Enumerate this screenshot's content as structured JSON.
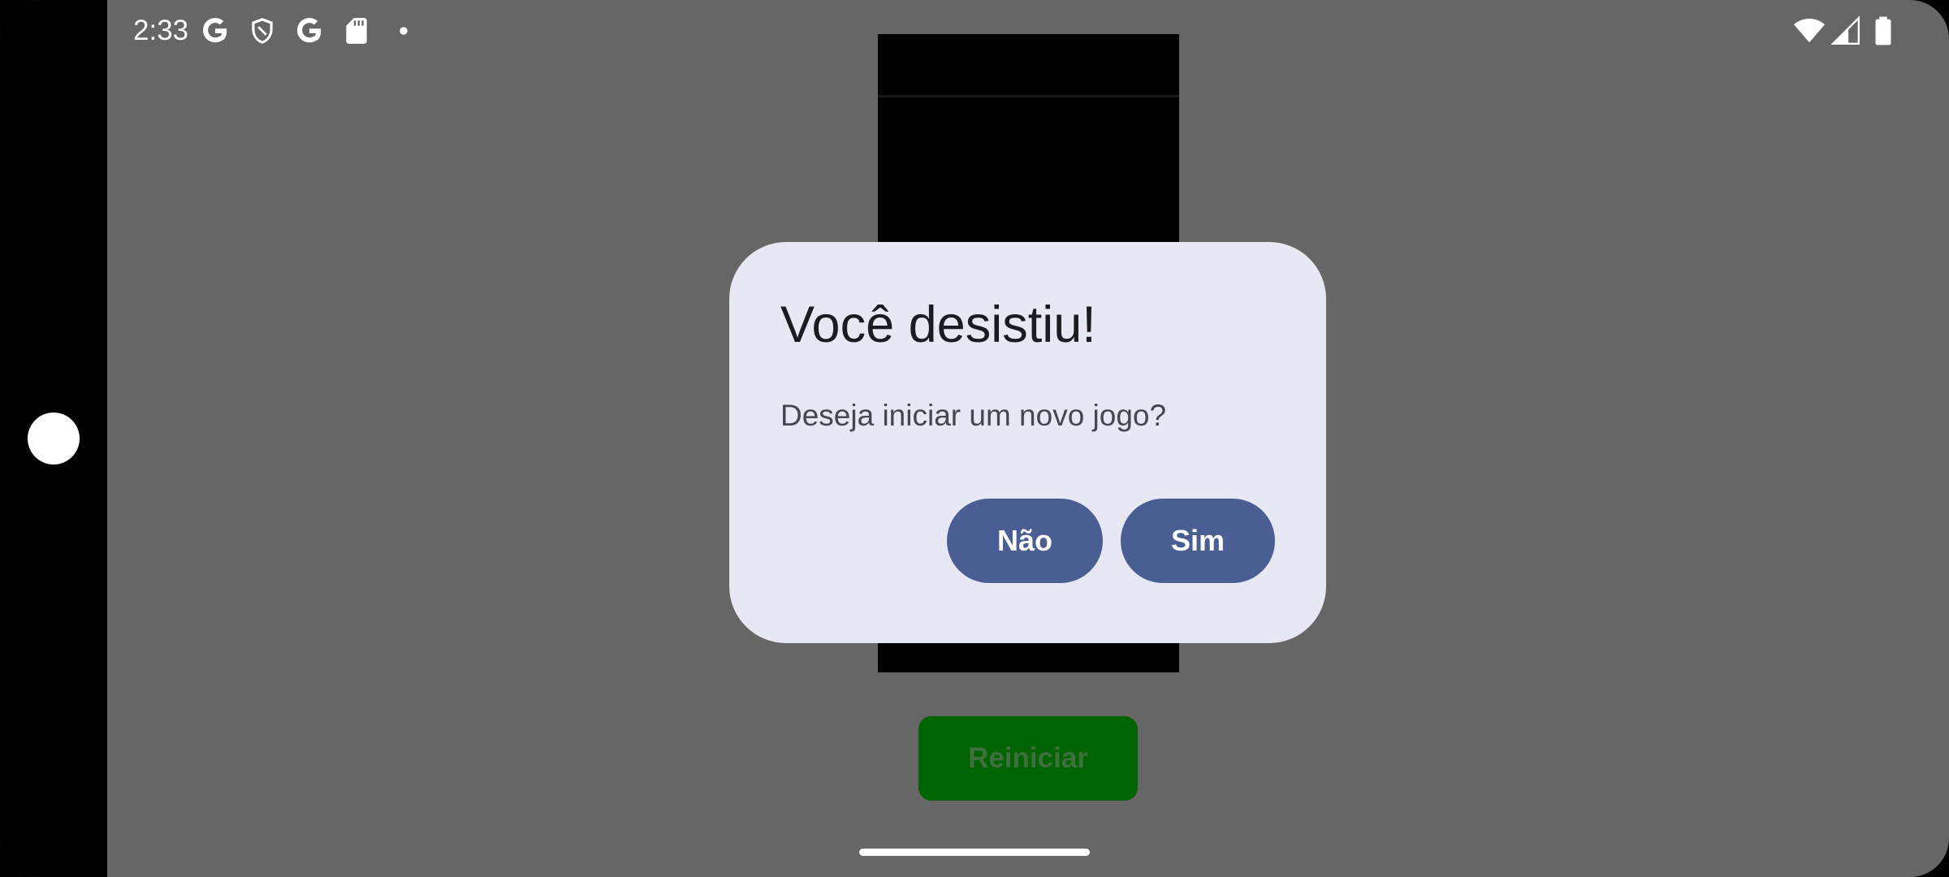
{
  "status_bar": {
    "time": "2:33",
    "left_icons": [
      "google-g-icon",
      "shield-icon",
      "google-g-icon",
      "sd-card-icon",
      "notification-dot-icon"
    ],
    "right_icons": [
      "wifi-icon",
      "cell-signal-icon",
      "battery-icon"
    ]
  },
  "game": {
    "restart_label": "Reiniciar"
  },
  "dialog": {
    "title": "Você desistiu!",
    "message": "Deseja iniciar um novo jogo?",
    "no_label": "Não",
    "yes_label": "Sim"
  },
  "colors": {
    "scrim": "#666666",
    "dialog_bg": "#e8e7f4",
    "dialog_button": "#4a5e94",
    "restart_button": "#006400"
  }
}
